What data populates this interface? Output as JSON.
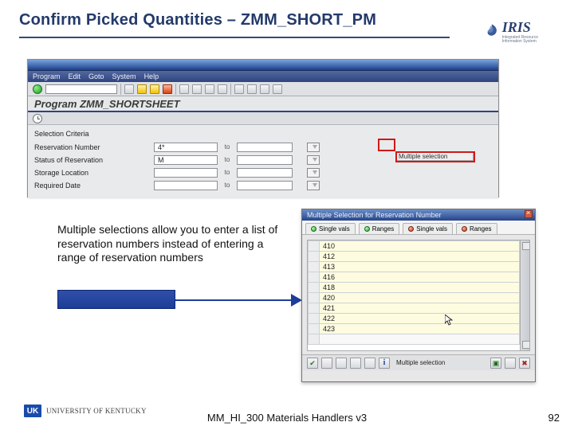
{
  "title": "Confirm Picked Quantities – ZMM_SHORT_PM",
  "iris": {
    "label": "IRIS",
    "sub": "Integrated Resource\nInformation System"
  },
  "sap_main": {
    "menu": [
      "Program",
      "Edit",
      "Goto",
      "System",
      "Help"
    ],
    "heading": "Program ZMM_SHORTSHEET",
    "section_title": "Selection Criteria",
    "rows": [
      {
        "label": "Reservation Number",
        "v1": "4*",
        "v2": ""
      },
      {
        "label": "Status of Reservation",
        "v1": "M",
        "v2": ""
      },
      {
        "label": "Storage Location",
        "v1": "",
        "v2": ""
      },
      {
        "label": "Required Date",
        "v1": "",
        "v2": ""
      }
    ],
    "to": "to",
    "multi_tooltip": "Multiple selection"
  },
  "explain": "Multiple selections allow you to enter a list of reservation numbers instead of entering a range of reservation numbers",
  "sap_popup": {
    "title": "Multiple Selection for Reservation Number",
    "tabs": [
      {
        "dot": "green",
        "text": "Single vals"
      },
      {
        "dot": "green",
        "text": "Ranges"
      },
      {
        "dot": "red",
        "text": "Single vals"
      },
      {
        "dot": "red",
        "text": "Ranges"
      }
    ],
    "values": [
      "410",
      "412",
      "413",
      "416",
      "418",
      "420",
      "421",
      "422",
      "423",
      ""
    ],
    "status": "Multiple selection"
  },
  "footer": {
    "uk": "UK",
    "uk_text": "UNIVERSITY OF KENTUCKY",
    "center": "MM_HI_300 Materials Handlers v3",
    "page": "92"
  }
}
